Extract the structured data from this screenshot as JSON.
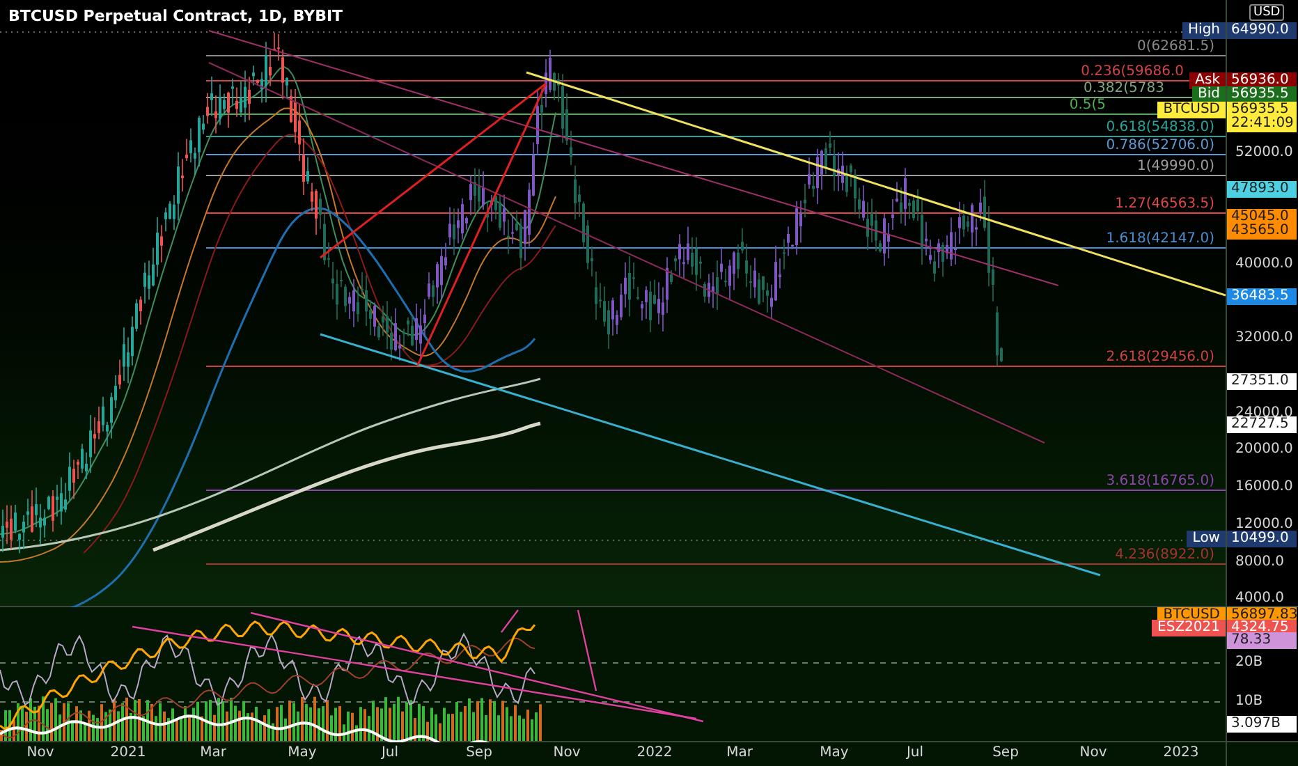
{
  "title": "BTCUSD Perpetual Contract, 1D, BYBIT",
  "currency": "USD",
  "fib_levels": [
    {
      "label": "0(62681.5)",
      "color": "#8a8a8a"
    },
    {
      "label": "0.236(59686.0",
      "color": "#d04545"
    },
    {
      "label": "0.382(5783",
      "color": "#7fa87f"
    },
    {
      "label": "0.5(5",
      "color": "#4caf50"
    },
    {
      "label": "0.618(54838.0)",
      "color": "#26a69a"
    },
    {
      "label": "0.786(52706.0)",
      "color": "#5b9bd5"
    },
    {
      "label": "1(49990.0)",
      "color": "#9e9e9e"
    },
    {
      "label": "1.27(46563.5)",
      "color": "#e04848"
    },
    {
      "label": "1.618(42147.0)",
      "color": "#4a8fd0"
    },
    {
      "label": "2.618(29456.0)",
      "color": "#d04040"
    },
    {
      "label": "3.618(16765.0)",
      "color": "#8e44ad"
    },
    {
      "label": "4.236(8922.0)",
      "color": "#a83232"
    }
  ],
  "price_ticks": [
    "52000.0",
    "40000.0",
    "32000.0",
    "24000.0",
    "20000.0",
    "16000.0",
    "12000.0",
    "8000.0",
    "4000.0"
  ],
  "price_tags": [
    {
      "label": "High",
      "values": [
        "64990.0"
      ],
      "color": "#1e3a6e"
    },
    {
      "label": "Ask",
      "values": [
        "56936.0"
      ],
      "color": "#8b0000"
    },
    {
      "label": "Bid",
      "values": [
        "56935.5"
      ],
      "color": "#1b6e1b"
    },
    {
      "label": "BTCUSD",
      "values": [
        "56935.5",
        "22:41:09"
      ],
      "color": "#ffeb3b"
    },
    {
      "values": [
        "47893.0"
      ],
      "color": "#4dd0e1"
    },
    {
      "values": [
        "45045.0",
        "43565.0"
      ],
      "color": "#ff8c00"
    },
    {
      "values": [
        "36483.5"
      ],
      "color": "#1e88e5"
    },
    {
      "values": [
        "27351.0"
      ],
      "color": "#ffffff"
    },
    {
      "values": [
        "22727.5"
      ],
      "color": "#ffffff"
    },
    {
      "label": "Low",
      "values": [
        "10499.0"
      ],
      "color": "#1e3a6e"
    }
  ],
  "indicator": {
    "ticks": [
      "20B",
      "10B"
    ],
    "tags": [
      {
        "label": "BTCUSD",
        "values": [
          "56897.83"
        ],
        "color": "#ff9800"
      },
      {
        "label": "ESZ2021",
        "values": [
          "4324.75"
        ],
        "color": "#ef5350"
      },
      {
        "values": [
          "78.33"
        ],
        "color": "#ce93d8"
      },
      {
        "values": [
          "3.097B"
        ],
        "color": "#ffffff"
      }
    ]
  },
  "time_axis": [
    "Nov",
    "2021",
    "Mar",
    "May",
    "Jul",
    "Sep",
    "Nov",
    "2022",
    "Mar",
    "May",
    "Jul",
    "Sep",
    "Nov",
    "2023"
  ]
}
